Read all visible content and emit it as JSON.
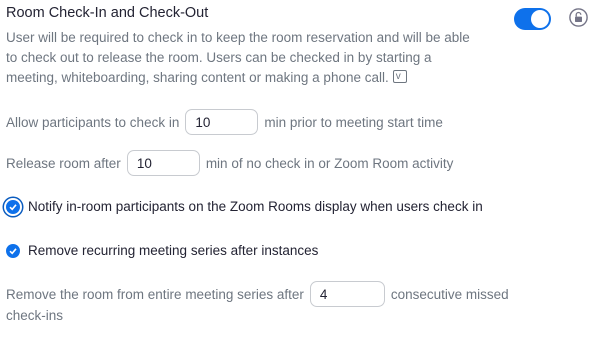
{
  "section": {
    "title": "Room Check-In and Check-Out",
    "description": "User will be required to check in to keep the room reservation and will be able to check out to release the room. Users can be checked in by starting a meeting, whiteboarding, sharing content or making a phone call.",
    "toggle_enabled": true,
    "icons": {
      "info": "info-expand-icon",
      "lock": "lock-icon",
      "check": "checkmark-icon"
    },
    "accent_color": "#0e71eb"
  },
  "checkin_prior": {
    "label_before": "Allow participants to check in",
    "value": "10",
    "label_after": "min prior to meeting start time"
  },
  "release_room": {
    "label_before": "Release room after",
    "value": "10",
    "label_after": "min of no check in or Zoom Room activity"
  },
  "notify_option": {
    "label": "Notify in-room participants on the Zoom Rooms display when users check in",
    "checked": true
  },
  "remove_recurring": {
    "label": "Remove recurring meeting series after instances",
    "checked": true
  },
  "remove_series": {
    "label_before": "Remove the room from entire meeting series after",
    "value": "4",
    "label_after": "consecutive missed",
    "label_wrap": "check-ins"
  }
}
